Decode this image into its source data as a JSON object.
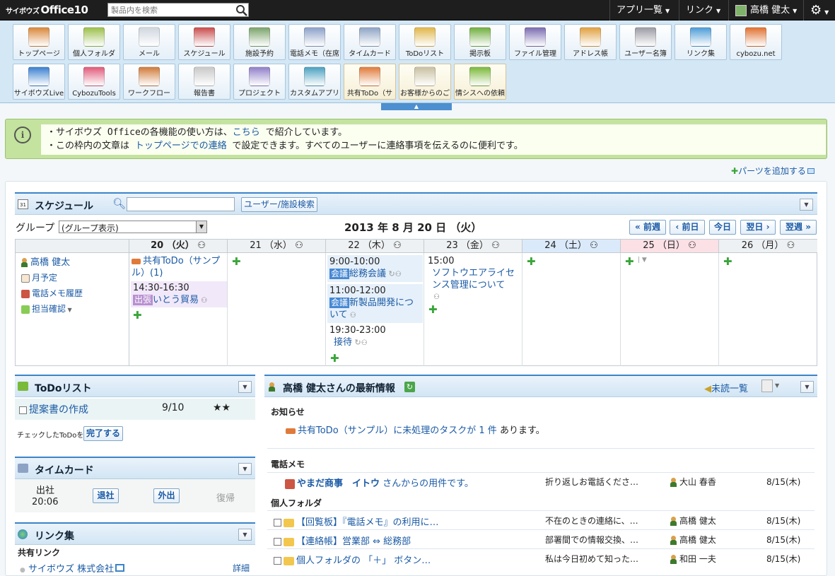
{
  "topbar": {
    "logo_small": "サイボウズ",
    "logo": "Office10",
    "search_placeholder": "製品内を検索",
    "menu_apps": "アプリ一覧",
    "menu_links": "リンク",
    "user_name": "高橋 健太"
  },
  "launcher": {
    "apps": [
      {
        "label": "トップページ",
        "icon": "house-icon"
      },
      {
        "label": "個人フォルダ",
        "icon": "folder-icon"
      },
      {
        "label": "メール",
        "icon": "mail-icon"
      },
      {
        "label": "スケジュール",
        "icon": "calendar-icon"
      },
      {
        "label": "施設予約",
        "icon": "whiteboard-icon"
      },
      {
        "label": "電話メモ（在席",
        "icon": "phone-memo-icon"
      },
      {
        "label": "タイムカード",
        "icon": "timecard-icon"
      },
      {
        "label": "ToDoリスト",
        "icon": "todo-icon"
      },
      {
        "label": "掲示板",
        "icon": "board-icon"
      },
      {
        "label": "ファイル管理",
        "icon": "binders-icon"
      },
      {
        "label": "アドレス帳",
        "icon": "address-book-icon"
      },
      {
        "label": "ユーザー名簿",
        "icon": "user-list-icon"
      },
      {
        "label": "リンク集",
        "icon": "globe-icon"
      },
      {
        "label": "cybozu.net",
        "icon": "chat-bubbles-icon"
      },
      {
        "label": "サイボウズLive",
        "icon": "live-icon"
      },
      {
        "label": "CybozuTools",
        "icon": "tools-icon"
      },
      {
        "label": "ワークフロー",
        "icon": "stamp-icon"
      },
      {
        "label": "報告書",
        "icon": "report-icon"
      },
      {
        "label": "プロジェクト",
        "icon": "project-icon"
      },
      {
        "label": "カスタムアプリ",
        "icon": "blocks-icon"
      },
      {
        "label": "共有ToDo（サ",
        "icon": "shared-todo-icon"
      },
      {
        "label": "お客様からのご",
        "icon": "customer-icon"
      },
      {
        "label": "情シスへの依頼",
        "icon": "request-icon"
      }
    ]
  },
  "notice": {
    "line1_a": "・サイボウズ Officeの各機能の使い方は、",
    "line1_link": "こちら",
    "line1_b": " で紹介しています。",
    "line2_a": "・この枠内の文章は ",
    "line2_link": "トップページでの連絡",
    "line2_b": " で設定できます。すべてのユーザーに連絡事項を伝えるのに便利です。"
  },
  "add_parts": "パーツを追加する",
  "schedule": {
    "title": "スケジュール",
    "search_button": "ユーザー/施設検索",
    "group_label": "グループ",
    "group_select": "(グループ表示)",
    "date_title": "2013 年 8 月 20 日 （火）",
    "nav": {
      "prev_week": "前週",
      "prev_day": "前日",
      "today": "今日",
      "next_day": "翌日",
      "next_week": "翌週"
    },
    "days": [
      {
        "label": "20 （火）"
      },
      {
        "label": "21 （水）"
      },
      {
        "label": "22 （木）"
      },
      {
        "label": "23 （金）"
      },
      {
        "label": "24 （土）"
      },
      {
        "label": "25 （日）"
      },
      {
        "label": "26 （月）"
      }
    ],
    "user": {
      "name": "高橋 健太",
      "monthly": "月予定",
      "phone_history": "電話メモ履歴",
      "assign_check": "担当確認"
    },
    "events": {
      "d20_todo": "共有ToDo（サンプル）(1)",
      "d20_time": "14:30-16:30",
      "d20_tag": "出張",
      "d20_text": "いとう貿易",
      "d22_1_time": "9:00-10:00",
      "d22_1_tag": "会議",
      "d22_1_text": "総務会議",
      "d22_2_time": "11:00-12:00",
      "d22_2_tag": "会議",
      "d22_2_text": "新製品開発について",
      "d22_3_time": "19:30-23:00",
      "d22_3_text": "接待",
      "d23_time": "15:00",
      "d23_text": "ソフトウエアライセンス管理について"
    }
  },
  "todo": {
    "title": "ToDoリスト",
    "item": "提案書の作成",
    "date": "9/10",
    "stars": "★★",
    "checked_label": "チェックしたToDoを",
    "done_button": "完了する"
  },
  "timecard": {
    "title": "タイムカード",
    "in_label": "出社",
    "in_time": "20:06",
    "leave": "退社",
    "out": "外出",
    "return": "復帰"
  },
  "links": {
    "title": "リンク集",
    "shared": "共有リンク",
    "item": "サイボウズ 株式会社",
    "detail": "詳細"
  },
  "news": {
    "title": "高橋 健太さんの最新情報",
    "unread": "未読一覧",
    "notice_section": "お知らせ",
    "notice_a": "共有ToDo（サンプル）に未処理のタスクが ",
    "notice_count": "1 件",
    "notice_b": " あります。",
    "phone_section": "電話メモ",
    "phone_row": {
      "company": "やまだ商事　イトウ",
      "text": "さんからの用件です。",
      "preview": "折り返しお電話くださ…",
      "person": "大山 春香",
      "date": "8/15(木)"
    },
    "folder_section": "個人フォルダ",
    "folder_rows": [
      {
        "title": "【回覧板】『電話メモ』の利用に…",
        "preview": "不在のときの連絡に、…",
        "person": "高橋 健太",
        "date": "8/15(木)"
      },
      {
        "title": "【連絡帳】営業部 ⇔ 総務部",
        "preview": "部署間での情報交換、…",
        "person": "高橋 健太",
        "date": "8/15(木)"
      },
      {
        "title": "個人フォルダの 「＋」 ボタン…",
        "preview": "私は今日初めて知った…",
        "person": "和田 一夫",
        "date": "8/15(木)"
      }
    ]
  }
}
